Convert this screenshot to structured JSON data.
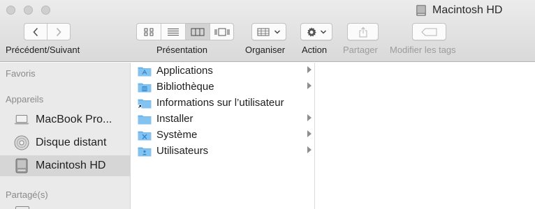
{
  "window": {
    "title": "Macintosh HD"
  },
  "toolbar": {
    "nav_label": "Précédent/Suivant",
    "view_label": "Présentation",
    "arrange_label": "Organiser",
    "action_label": "Action",
    "share_label": "Partager",
    "tags_label": "Modifier les tags",
    "active_view": "column"
  },
  "sidebar": {
    "favorites_header": "Favoris",
    "devices_header": "Appareils",
    "shared_header": "Partagé(s)",
    "devices": [
      {
        "label": "MacBook Pro...",
        "icon": "laptop-icon"
      },
      {
        "label": "Disque distant",
        "icon": "optical-disc-icon"
      },
      {
        "label": "Macintosh HD",
        "icon": "hard-drive-icon",
        "selected": true
      }
    ]
  },
  "column1": {
    "items": [
      {
        "name": "Applications",
        "icon": "applications-folder-icon",
        "has_children": true
      },
      {
        "name": "Bibliothèque",
        "icon": "library-folder-icon",
        "has_children": true
      },
      {
        "name": "Informations sur l’utilisateur",
        "icon": "alias-folder-icon",
        "has_children": false
      },
      {
        "name": "Installer",
        "icon": "folder-icon",
        "has_children": true
      },
      {
        "name": "Système",
        "icon": "system-folder-icon",
        "has_children": true
      },
      {
        "name": "Utilisateurs",
        "icon": "users-folder-icon",
        "has_children": true
      }
    ]
  },
  "colors": {
    "folder": "#6fb6ea",
    "folder_dark": "#4a9be0",
    "sidebar_bg": "#eaeaea",
    "selected_bg": "#d6d6d6"
  }
}
